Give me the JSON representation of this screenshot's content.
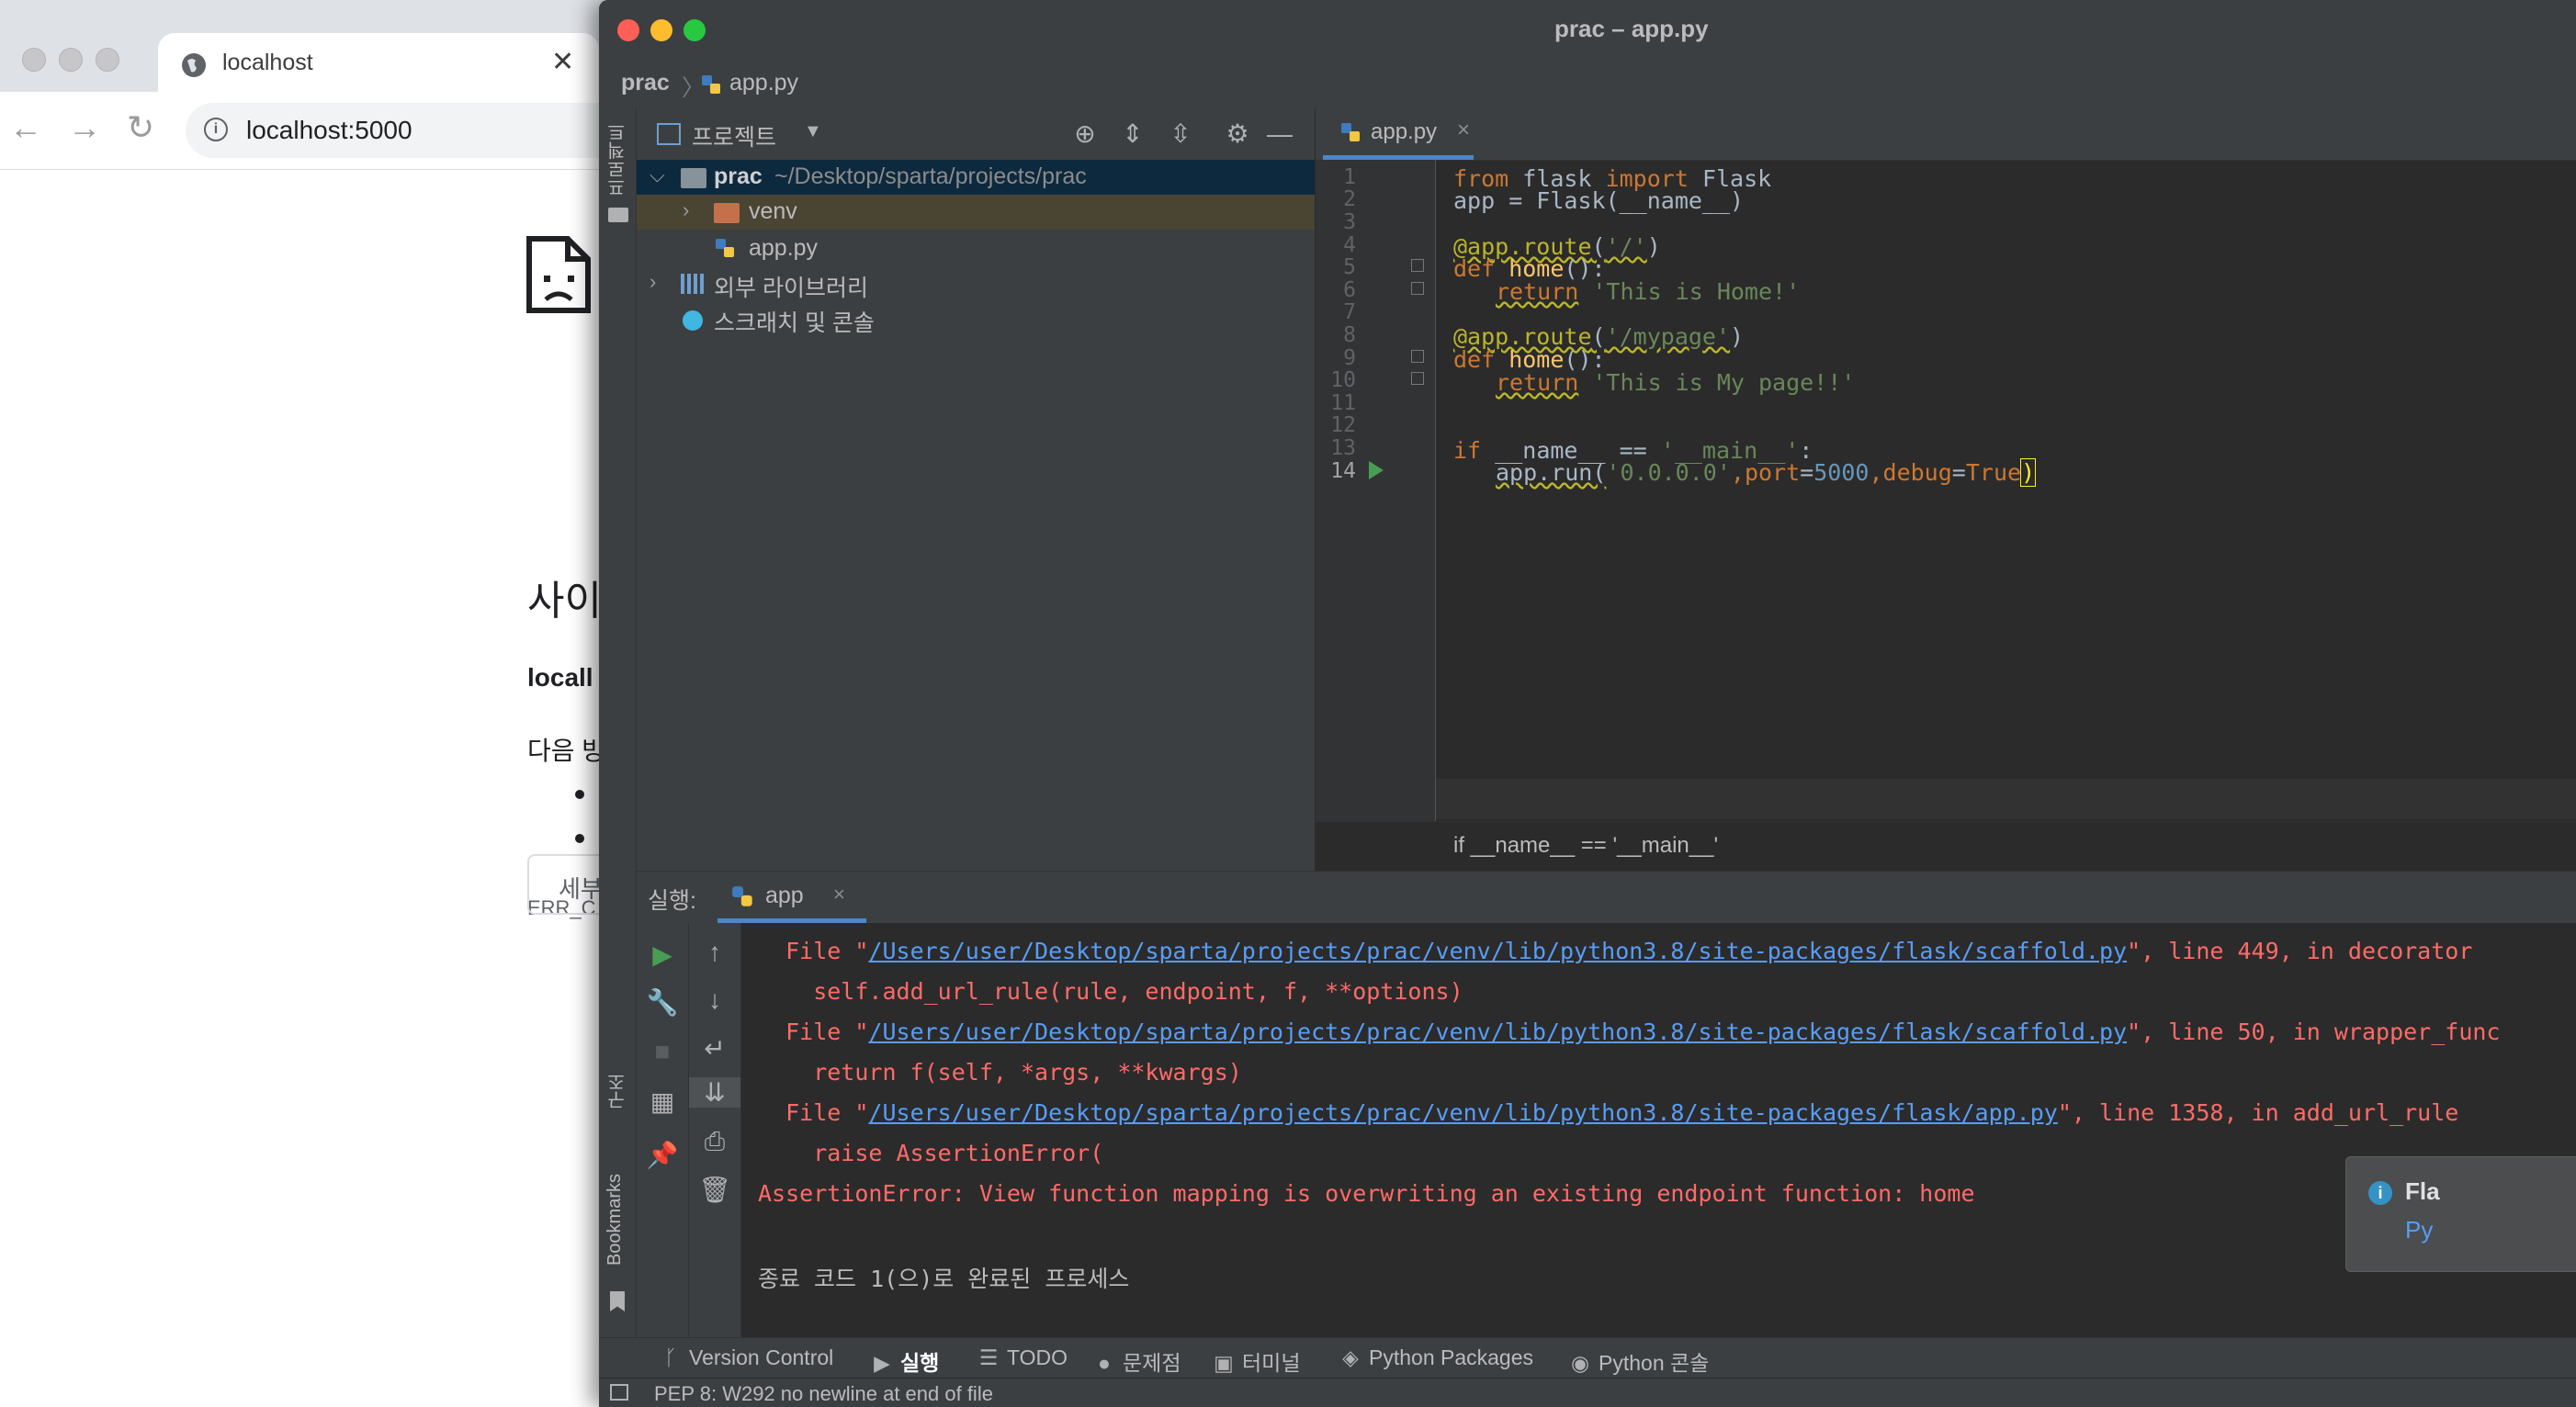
{
  "browser": {
    "tab_title": "localhost",
    "url": "localhost:5000",
    "error_title": "사이",
    "error_host": "locall",
    "error_hint": "다음 방",
    "error_code": "ERR_C",
    "details_button": "세부"
  },
  "ide": {
    "window_title": "prac – app.py",
    "breadcrumb": {
      "project": "prac",
      "file": "app.py"
    },
    "stripe": {
      "project_label": "프로젝트",
      "structure_label": "구조",
      "bookmarks_label": "Bookmarks"
    },
    "project_panel": {
      "title": "프로젝트",
      "tree": [
        {
          "name": "prac",
          "path": "~/Desktop/sparta/projects/prac"
        },
        {
          "name": "venv"
        },
        {
          "name": "app.py"
        },
        {
          "name": "외부 라이브러리"
        },
        {
          "name": "스크래치 및 콘솔"
        }
      ]
    },
    "editor": {
      "tab": "app.py",
      "line_numbers": [
        "1",
        "2",
        "3",
        "4",
        "5",
        "6",
        "7",
        "8",
        "9",
        "10",
        "11",
        "12",
        "13",
        "14"
      ],
      "lines": {
        "l1_from": "from",
        "l1_mod": " flask ",
        "l1_import": "import",
        "l1_cls": " Flask",
        "l2": "app = Flask(__name__)",
        "l4_dec": "@app.route",
        "l4_open": "(",
        "l4_str": "'/'",
        "l4_close": ")",
        "l5_def": "def",
        "l5_fn": " home",
        "l5_rest": "():",
        "l6_ret": "return",
        "l6_str": " 'This is Home!'",
        "l8_dec": "@app.route",
        "l8_open": "(",
        "l8_str": "'/mypage'",
        "l8_close": ")",
        "l9_def": "def",
        "l9_fn": " home",
        "l9_rest": "():",
        "l10_ret": "return",
        "l10_str": " 'This is My page!!'",
        "l13_if": "if",
        "l13_mid": " __name__ == ",
        "l13_str": "'__main__'",
        "l13_end": ":",
        "l14_a": "app.run(",
        "l14_s": "'0.0.0.0'",
        "l14_c1": ",",
        "l14_port": "port",
        "l14_eq1": "=",
        "l14_num": "5000",
        "l14_c2": ",",
        "l14_debug": "debug",
        "l14_eq2": "=",
        "l14_true": "True",
        "l14_close": ")"
      },
      "status_context": "if __name__ == '__main__'"
    },
    "run": {
      "label": "실행:",
      "tab": "app",
      "output": [
        {
          "pre": "  File \"",
          "link": "/Users/user/Desktop/sparta/projects/prac/venv/lib/python3.8/site-packages/flask/scaffold.py",
          "post": "\", line 449, in decorator"
        },
        {
          "text": "    self.add_url_rule(rule, endpoint, f, **options)"
        },
        {
          "pre": "  File \"",
          "link": "/Users/user/Desktop/sparta/projects/prac/venv/lib/python3.8/site-packages/flask/scaffold.py",
          "post": "\", line 50, in wrapper_func"
        },
        {
          "text": "    return f(self, *args, **kwargs)"
        },
        {
          "pre": "  File \"",
          "link": "/Users/user/Desktop/sparta/projects/prac/venv/lib/python3.8/site-packages/flask/app.py",
          "post": "\", line 1358, in add_url_rule"
        },
        {
          "text": "    raise AssertionError("
        },
        {
          "text": "AssertionError: View function mapping is overwriting an existing endpoint function: home"
        },
        {
          "text": "종료 코드 1(으)로 완료된 프로세스"
        }
      ],
      "notification": {
        "title": "Fla",
        "body": "Py"
      }
    },
    "tool_windows": [
      "Version Control",
      "실행",
      "TODO",
      "문제점",
      "터미널",
      "Python Packages",
      "Python 콘솔"
    ],
    "status_bar": "PEP 8: W292 no newline at end of file",
    "colors": {
      "keyword": "#cc7832",
      "string": "#6a8759",
      "decorator": "#bbb529",
      "number": "#6897bb",
      "error": "#ff6b68",
      "link": "#589df6",
      "accent": "#4a88c7"
    }
  }
}
